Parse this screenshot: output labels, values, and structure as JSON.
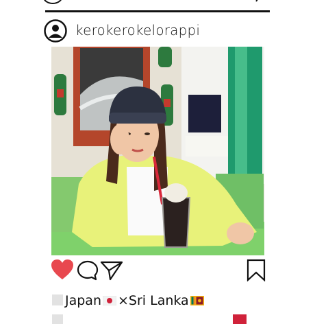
{
  "post": {
    "username": "kerokerokelorappi"
  },
  "caption": {
    "line1_part1": "Japan",
    "line1_sep": "×",
    "line1_part2": "Sri Lanka"
  },
  "icons": {
    "avatar": "user-icon",
    "like": "heart-icon",
    "comment": "comment-icon",
    "share": "send-icon",
    "save": "bookmark-icon"
  },
  "colors": {
    "like": "#e8484f",
    "frame": "#111111"
  }
}
